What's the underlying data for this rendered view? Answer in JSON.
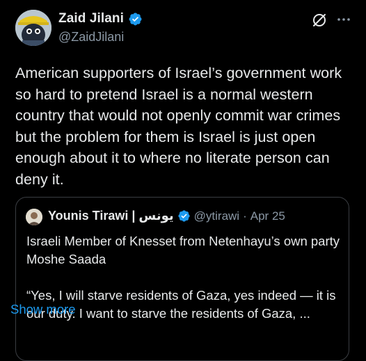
{
  "author": {
    "display_name": "Zaid Jilani",
    "handle": "@ZaidJilani",
    "avatar_icon": "avatar-cartoon-icon",
    "verified_icon": "verified-badge-icon"
  },
  "actions": {
    "grok_icon": "grok-slash-icon",
    "more_icon": "more-horizontal-icon"
  },
  "tweet": {
    "text": "American supporters of Israel’s government work so hard to pretend Israel is a normal western country that would not openly commit war crimes but the problem for them is Israel is just open enough about it to where no literate person can deny it."
  },
  "quote": {
    "display_name": "Younis Tirawi | يونس",
    "handle": "@ytirawi",
    "separator": "·",
    "date": "Apr 25",
    "paragraph1": "Israeli Member of Knesset from Netenhayu’s own party Moshe Saada",
    "paragraph2": "“Yes, I will starve residents of Gaza, yes indeed — it is our duty. I want to starve the residents of Gaza, ...",
    "show_more": "Show more"
  },
  "colors": {
    "background": "#000000",
    "text": "#e7e9ea",
    "secondary": "#8b98a5",
    "link": "#1d9bf0",
    "verified": "#1d9bf0",
    "border": "#3a3d42"
  }
}
